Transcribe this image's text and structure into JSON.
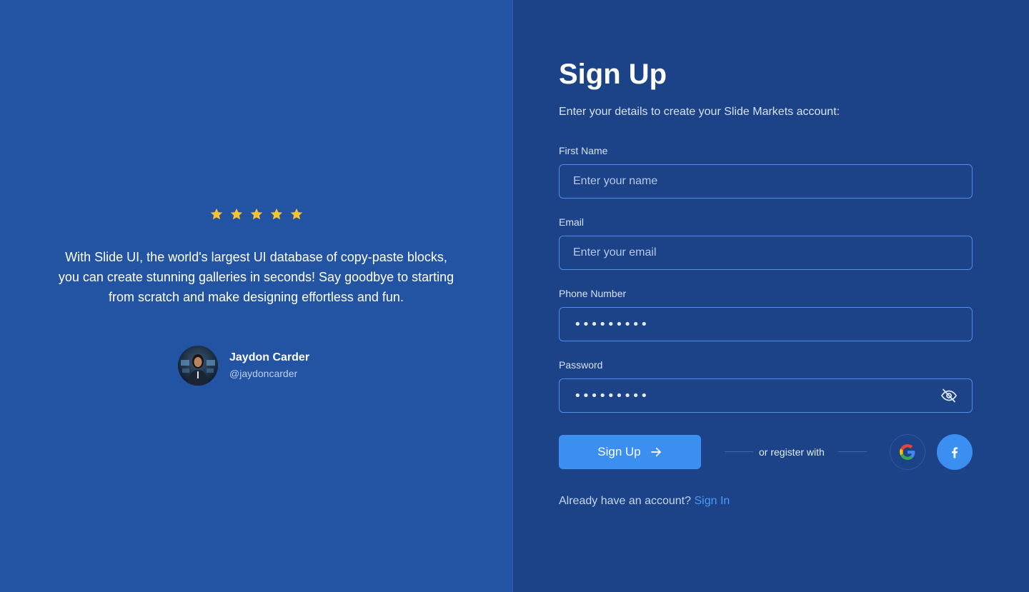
{
  "testimonial": {
    "rating": 5,
    "quote": "With Slide UI, the world's largest UI database of copy-paste blocks, you can create stunning galleries in seconds! Say goodbye to starting from scratch and make designing effortless and fun.",
    "author_name": "Jaydon Carder",
    "author_handle": "@jaydoncarder"
  },
  "form": {
    "title": "Sign Up",
    "subtitle": "Enter your details to create your Slide Markets account:",
    "first_name": {
      "label": "First Name",
      "placeholder": "Enter your name"
    },
    "email": {
      "label": "Email",
      "placeholder": "Enter your email"
    },
    "phone": {
      "label": "Phone Number",
      "value": "•••••••••"
    },
    "password": {
      "label": "Password",
      "value": "•••••••••"
    },
    "submit_label": "Sign Up",
    "or_register_text": "or register with",
    "social_icons": [
      "google-icon",
      "facebook-icon"
    ],
    "signin_prompt": "Already have an account?",
    "signin_link": "Sign In"
  },
  "colors": {
    "left_bg": "#2354a3",
    "right_bg": "#1c4288",
    "accent": "#3b8ff1",
    "star": "#f6c22f"
  }
}
